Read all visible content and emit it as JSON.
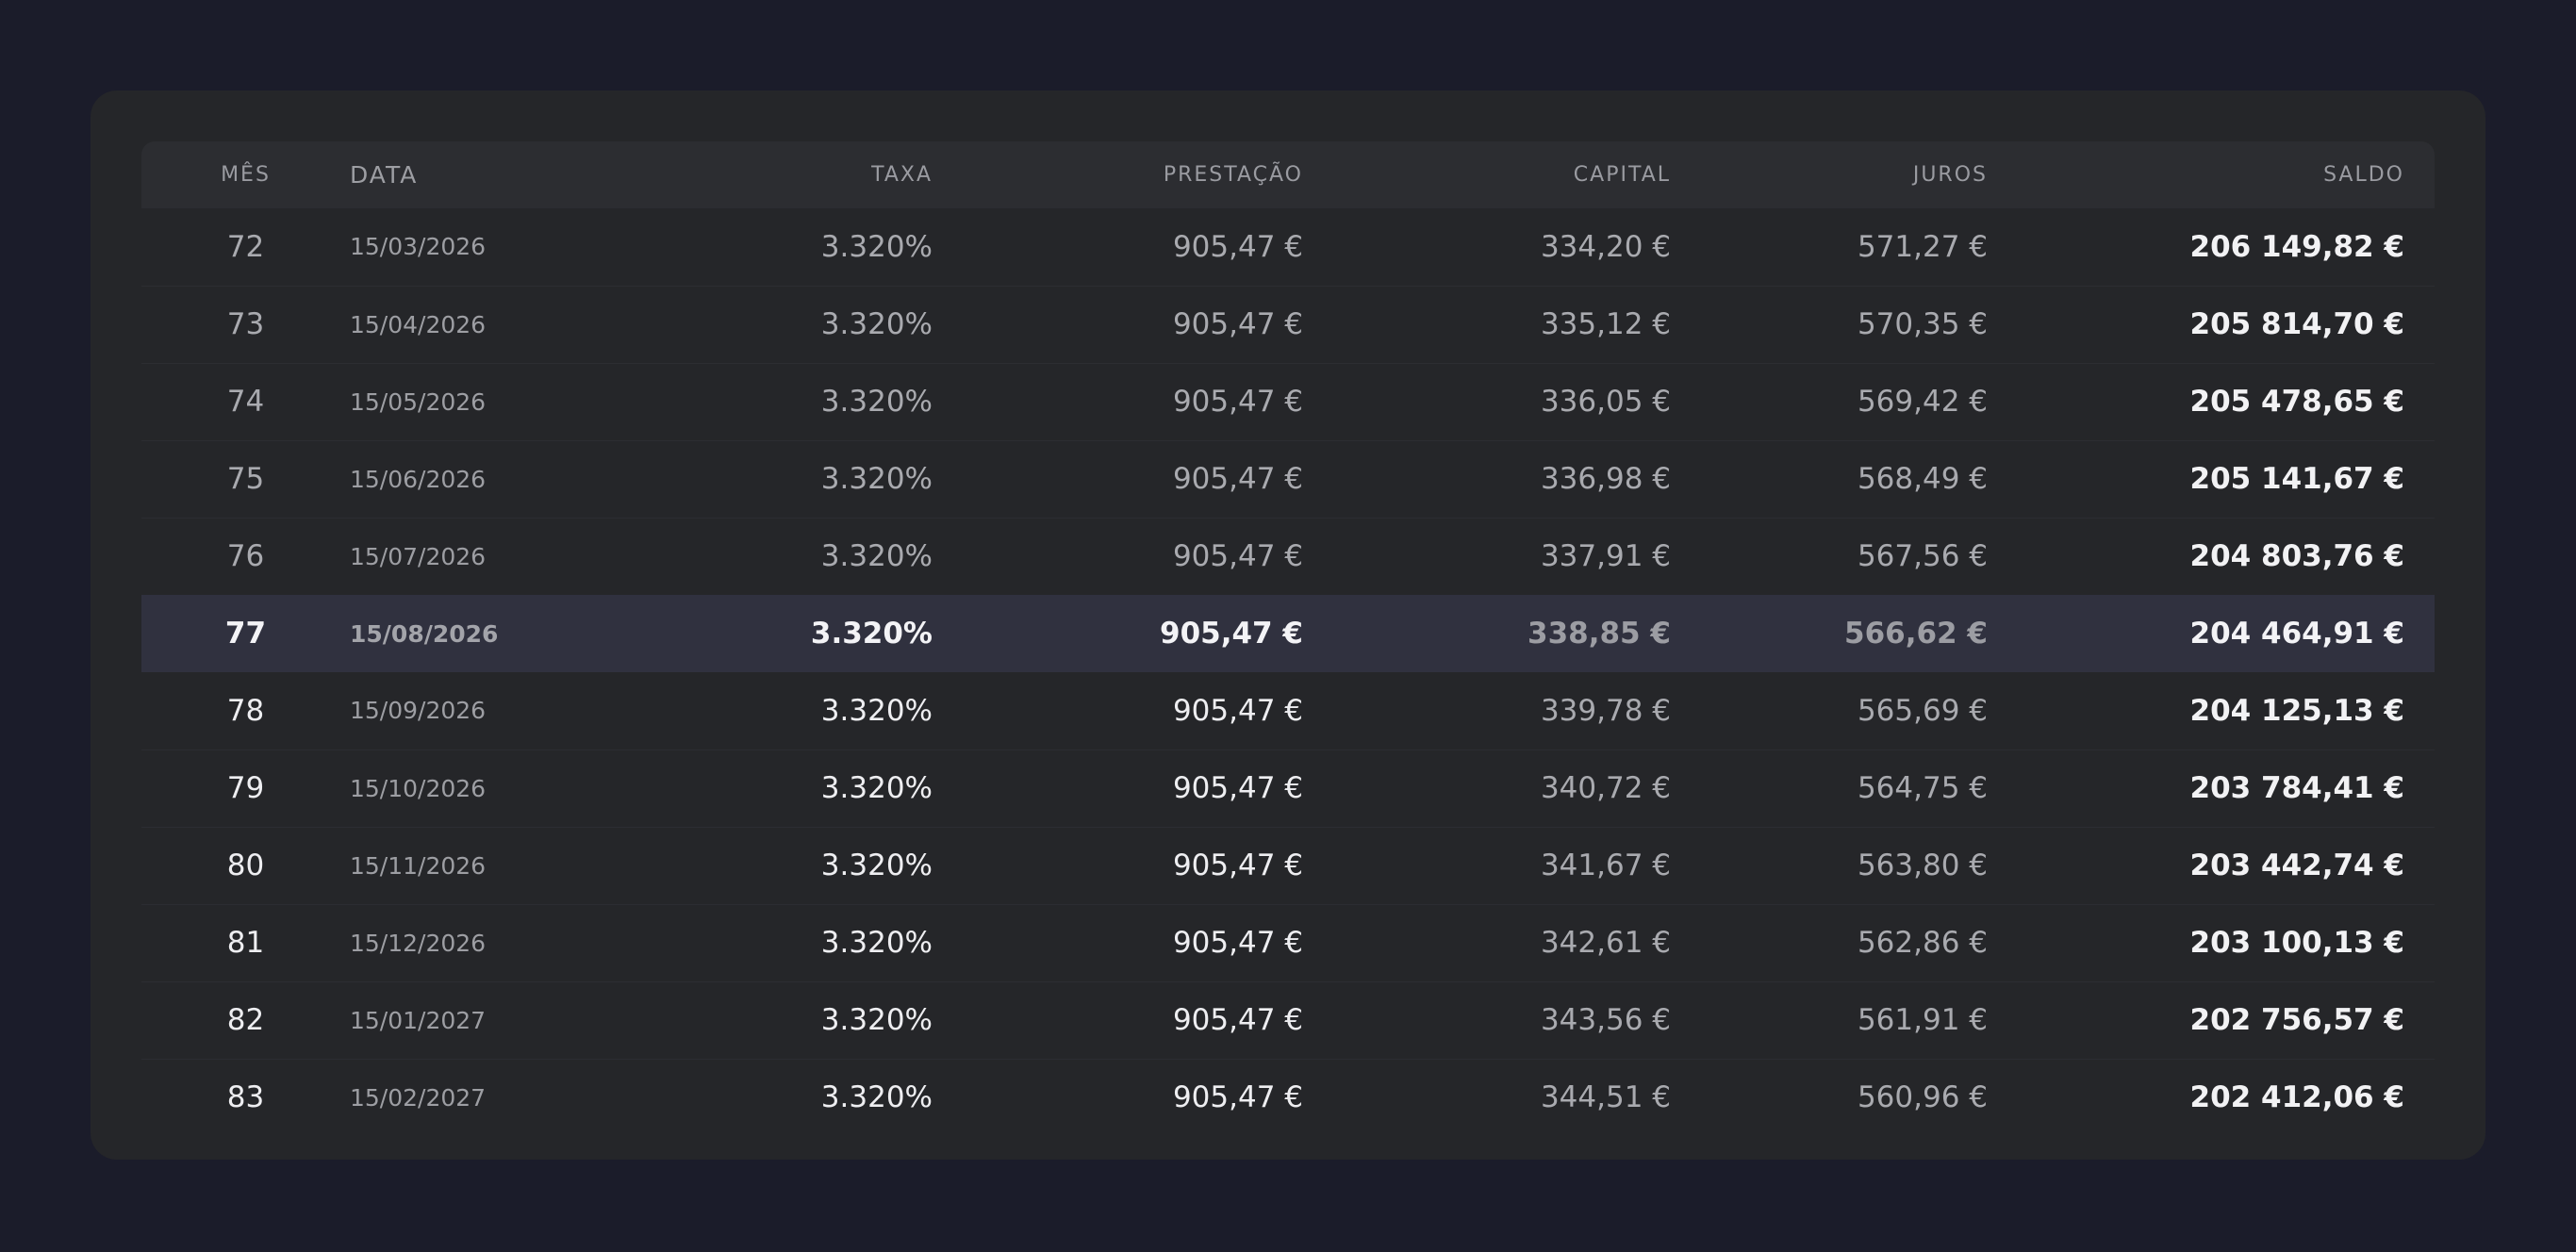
{
  "table": {
    "headers": {
      "mes": "MÊS",
      "data": "DATA",
      "taxa": "TAXA",
      "prestacao": "PRESTAÇÃO",
      "capital": "CAPITAL",
      "juros": "JUROS",
      "saldo": "SALDO"
    },
    "current_month": "77",
    "rows": [
      {
        "mes": "72",
        "data": "15/03/2026",
        "taxa": "3.320%",
        "prestacao": "905,47 €",
        "capital": "334,20 €",
        "juros": "571,27 €",
        "saldo": "206 149,82 €"
      },
      {
        "mes": "73",
        "data": "15/04/2026",
        "taxa": "3.320%",
        "prestacao": "905,47 €",
        "capital": "335,12 €",
        "juros": "570,35 €",
        "saldo": "205 814,70 €"
      },
      {
        "mes": "74",
        "data": "15/05/2026",
        "taxa": "3.320%",
        "prestacao": "905,47 €",
        "capital": "336,05 €",
        "juros": "569,42 €",
        "saldo": "205 478,65 €"
      },
      {
        "mes": "75",
        "data": "15/06/2026",
        "taxa": "3.320%",
        "prestacao": "905,47 €",
        "capital": "336,98 €",
        "juros": "568,49 €",
        "saldo": "205 141,67 €"
      },
      {
        "mes": "76",
        "data": "15/07/2026",
        "taxa": "3.320%",
        "prestacao": "905,47 €",
        "capital": "337,91 €",
        "juros": "567,56 €",
        "saldo": "204 803,76 €"
      },
      {
        "mes": "77",
        "data": "15/08/2026",
        "taxa": "3.320%",
        "prestacao": "905,47 €",
        "capital": "338,85 €",
        "juros": "566,62 €",
        "saldo": "204 464,91 €"
      },
      {
        "mes": "78",
        "data": "15/09/2026",
        "taxa": "3.320%",
        "prestacao": "905,47 €",
        "capital": "339,78 €",
        "juros": "565,69 €",
        "saldo": "204 125,13 €"
      },
      {
        "mes": "79",
        "data": "15/10/2026",
        "taxa": "3.320%",
        "prestacao": "905,47 €",
        "capital": "340,72 €",
        "juros": "564,75 €",
        "saldo": "203 784,41 €"
      },
      {
        "mes": "80",
        "data": "15/11/2026",
        "taxa": "3.320%",
        "prestacao": "905,47 €",
        "capital": "341,67 €",
        "juros": "563,80 €",
        "saldo": "203 442,74 €"
      },
      {
        "mes": "81",
        "data": "15/12/2026",
        "taxa": "3.320%",
        "prestacao": "905,47 €",
        "capital": "342,61 €",
        "juros": "562,86 €",
        "saldo": "203 100,13 €"
      },
      {
        "mes": "82",
        "data": "15/01/2027",
        "taxa": "3.320%",
        "prestacao": "905,47 €",
        "capital": "343,56 €",
        "juros": "561,91 €",
        "saldo": "202 756,57 €"
      },
      {
        "mes": "83",
        "data": "15/02/2027",
        "taxa": "3.320%",
        "prestacao": "905,47 €",
        "capital": "344,51 €",
        "juros": "560,96 €",
        "saldo": "202 412,06 €"
      }
    ]
  },
  "colors": {
    "page_background": "#1b1c2a",
    "card_background": "#252629",
    "header_background": "#2c2d31",
    "current_row_background": "#30313f",
    "primary_text": "#f2f2f4",
    "muted_text": "#a9aaaf"
  }
}
